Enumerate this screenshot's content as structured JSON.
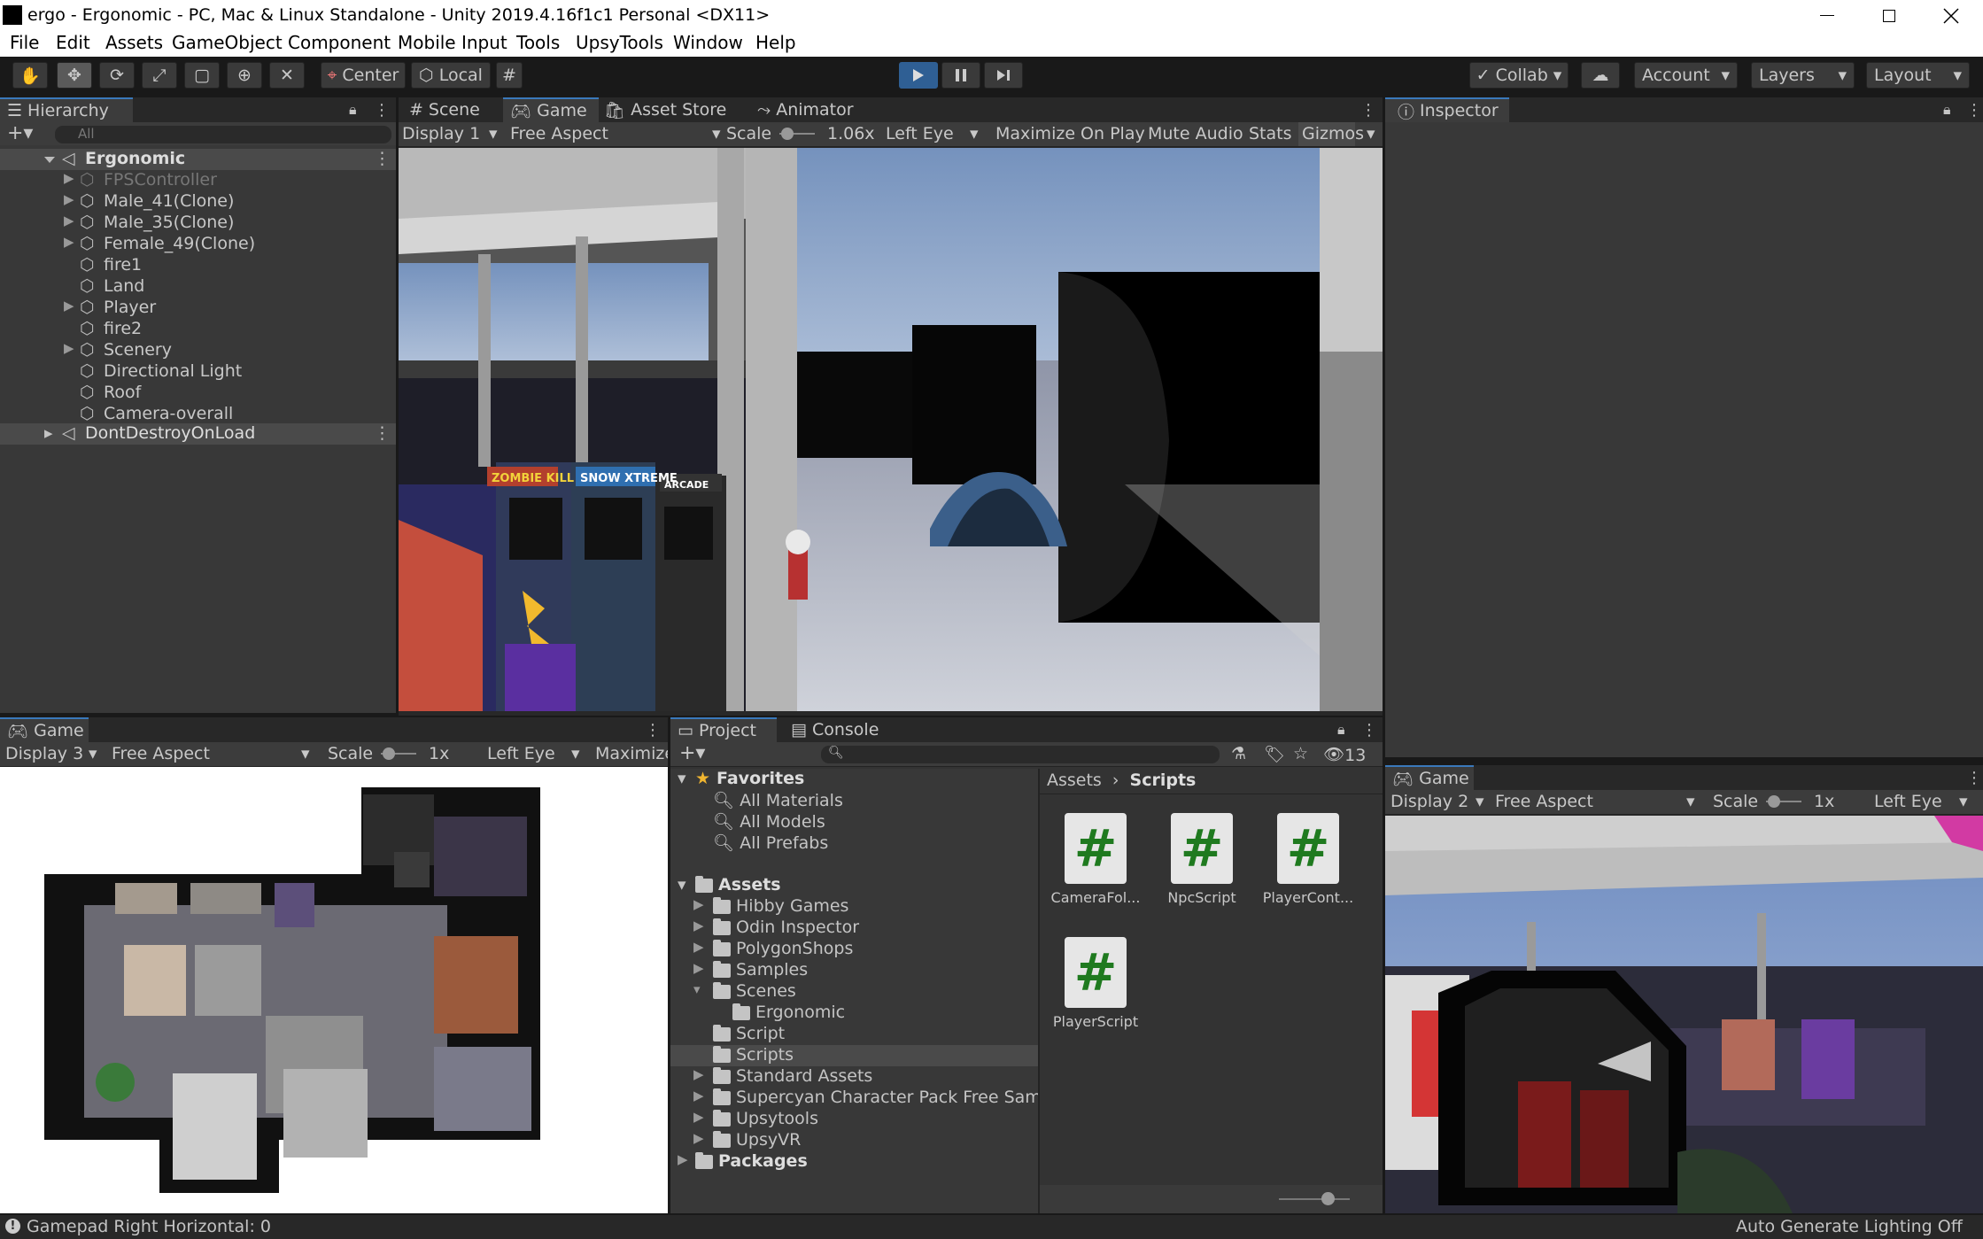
{
  "window": {
    "title": "ergo - Ergonomic - PC, Mac & Linux Standalone - Unity 2019.4.16f1c1 Personal <DX11>"
  },
  "menu": [
    "File",
    "Edit",
    "Assets",
    "GameObject",
    "Component",
    "Mobile Input",
    "Tools",
    "UpsyTools",
    "Window",
    "Help"
  ],
  "toolbar": {
    "pivot": "Center",
    "space": "Local",
    "collab": "Collab",
    "account": "Account",
    "layers": "Layers",
    "layout": "Layout"
  },
  "hierarchy": {
    "tab": "Hierarchy",
    "search_placeholder": "All",
    "scene": "Ergonomic",
    "items": [
      "FPSController",
      "Male_41(Clone)",
      "Male_35(Clone)",
      "Female_49(Clone)",
      "fire1",
      "Land",
      "Player",
      "fire2",
      "Scenery",
      "Directional Light",
      "Roof",
      "Camera-overall"
    ],
    "dont_destroy": "DontDestroyOnLoad"
  },
  "center_tabs": [
    "Scene",
    "Game",
    "Asset Store",
    "Animator"
  ],
  "game1": {
    "display": "Display 1",
    "aspect": "Free Aspect",
    "scale_label": "Scale",
    "scale": "1.06x",
    "eye": "Left Eye",
    "maximize": "Maximize On Play",
    "mute": "Mute Audio",
    "stats": "Stats",
    "gizmos": "Gizmos",
    "sign1": "ZOMBIE KILL",
    "sign2": "SNOW XTREME",
    "sign3": "ARCADE"
  },
  "inspector": {
    "tab": "Inspector"
  },
  "game3": {
    "tab": "Game",
    "display": "Display 3",
    "aspect": "Free Aspect",
    "scale_label": "Scale",
    "scale": "1x",
    "eye": "Left Eye",
    "maximize": "Maximize"
  },
  "project": {
    "tab": "Project",
    "console_tab": "Console",
    "hidden_count": "13",
    "favorites": "Favorites",
    "fav_items": [
      "All Materials",
      "All Models",
      "All Prefabs"
    ],
    "assets": "Assets",
    "folders": [
      "Hibby Games",
      "Odin Inspector",
      "PolygonShops",
      "Samples",
      "Scenes"
    ],
    "scenes_child": "Ergonomic",
    "folders2": [
      "Script",
      "Scripts",
      "Standard Assets",
      "Supercyan Character Pack Free Sampl",
      "Upsytools",
      "UpsyVR"
    ],
    "packages": "Packages",
    "breadcrumb_root": "Assets",
    "breadcrumb_current": "Scripts",
    "files": [
      "CameraFol...",
      "NpcScript",
      "PlayerCont...",
      "PlayerScript"
    ],
    "file_icon": "#"
  },
  "game2": {
    "tab": "Game",
    "display": "Display 2",
    "aspect": "Free Aspect",
    "scale_label": "Scale",
    "scale": "1x",
    "eye": "Left Eye"
  },
  "status": {
    "left": "Gamepad Right Horizontal: 0",
    "right": "Auto Generate Lighting Off"
  }
}
